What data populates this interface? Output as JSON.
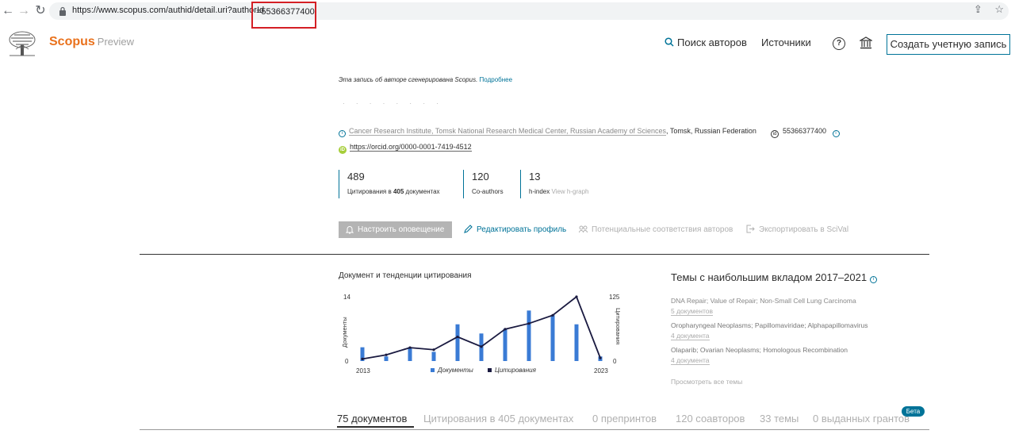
{
  "browser": {
    "url_prefix": "https://www.scopus.com/authid/detail.uri?authorId",
    "url_highlight": "=55366377400"
  },
  "header": {
    "brand": "Scopus",
    "brand_suffix": "Preview",
    "search_authors": "Поиск авторов",
    "sources": "Источники",
    "help": "?",
    "create_account": "Создать учетную запись"
  },
  "profile": {
    "notice": "Эта запись об авторе сгенерирована Scopus.",
    "notice_more": "Подробнее",
    "name_placeholder": "· · · · ·  · · ·",
    "affiliation": "Cancer Research Institute, Tomsk National Research Medical Center, Russian Academy of Sciences",
    "city": ", Tomsk, Russian Federation",
    "author_id": "55366377400",
    "orcid": "https://orcid.org/0000-0001-7419-4512"
  },
  "metrics": [
    {
      "value": "489",
      "label_pre": "Цитирования в ",
      "label_bold": "405",
      "label_post": " документах"
    },
    {
      "value": "120",
      "label": "Co-authors"
    },
    {
      "value": "13",
      "label": "h-index",
      "label_muted": "View h-graph"
    }
  ],
  "actions": {
    "alert": "Настроить оповещение",
    "edit": "Редактировать профиль",
    "potential": "Потенциальные соответствия авторов",
    "export": "Экспортировать в SciVal"
  },
  "chart_title": "Документ и тенденции цитирования",
  "chart_data": {
    "type": "bar",
    "x": [
      2013,
      2014,
      2015,
      2016,
      2017,
      2018,
      2019,
      2020,
      2021,
      2022,
      2023
    ],
    "x_tick_labels": [
      "2013",
      "2023"
    ],
    "ylabel_left": "Документы",
    "ylabel_right": "Цитирования",
    "ylim_left": [
      0,
      14
    ],
    "ylim_right": [
      0,
      125
    ],
    "series": [
      {
        "name": "Документы",
        "axis": "left",
        "type": "bar",
        "color": "#3a7bd5",
        "values": [
          3,
          1,
          3,
          2,
          8,
          6,
          7,
          11,
          10,
          8,
          1
        ]
      },
      {
        "name": "Цитирования",
        "axis": "right",
        "type": "line",
        "color": "#1a1a40",
        "values": [
          4,
          12,
          26,
          22,
          47,
          28,
          62,
          73,
          89,
          125,
          6
        ]
      }
    ],
    "legend": "bottom",
    "grid": false
  },
  "topics": {
    "title": "Темы с наибольшим вкладом 2017–2021",
    "items": [
      {
        "name": "DNA Repair; Value of Repair; Non-Small Cell Lung Carcinoma",
        "docs": "5 документов"
      },
      {
        "name": "Oropharyngeal Neoplasms; Papillomaviridae; Alphapapillomavirus",
        "docs": "4 документа"
      },
      {
        "name": "Olaparib; Ovarian Neoplasms; Homologous Recombination",
        "docs": "4 документа"
      }
    ],
    "all": "Просмотреть все темы"
  },
  "tabs": [
    "75 документов",
    "Цитирования в 405 документах",
    "0 препринтов",
    "120 соавторов",
    "33 темы",
    "0 выданных грантов"
  ],
  "beta": "Бета"
}
